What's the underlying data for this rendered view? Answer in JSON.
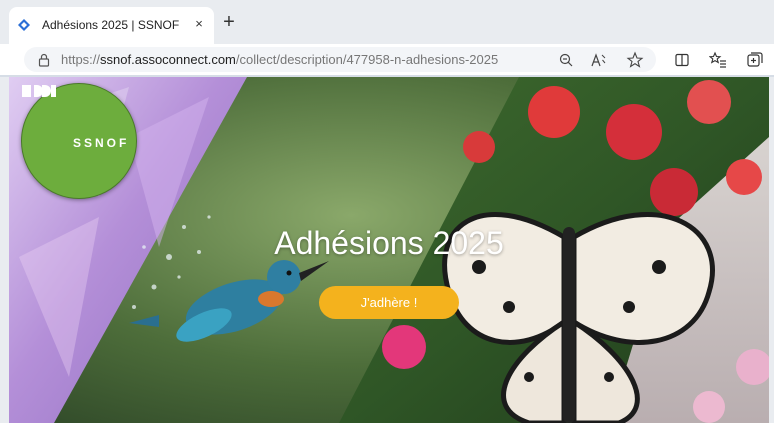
{
  "browser": {
    "tab_title": "Adhésions 2025 | SSNOF",
    "tab_close": "×",
    "new_tab": "+",
    "url_prefix": "https://",
    "url_host": "ssnof.assoconnect.com",
    "url_path": "/collect/description/477958-n-adhesions-2025",
    "icons": [
      "favicon-icon",
      "lock-icon",
      "zoom-out-icon",
      "read-aloud-icon",
      "favorite-icon",
      "split-screen-icon",
      "favorites-list-icon",
      "collections-icon"
    ]
  },
  "page": {
    "logo_text": "SSNOF",
    "title": "Adhésions 2025",
    "cta_label": "J'adhère !",
    "accent_color": "#f4b21d",
    "logo_color": "#6dad3d"
  }
}
